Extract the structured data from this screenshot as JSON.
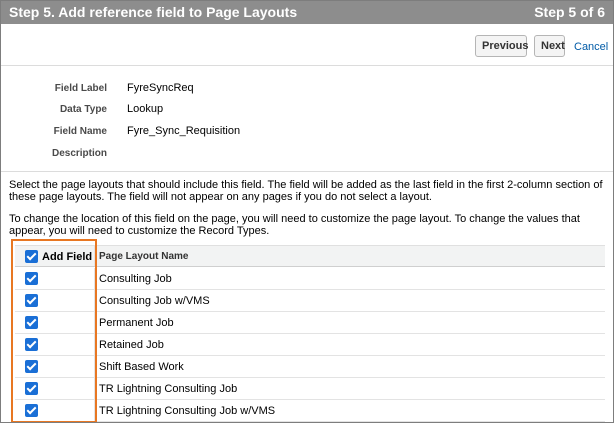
{
  "header": {
    "title": "Step 5. Add reference field to Page Layouts",
    "step": "Step 5 of 6"
  },
  "buttons": {
    "previous": "Previous",
    "next": "Next",
    "cancel": "Cancel"
  },
  "fields": [
    {
      "label": "Field Label",
      "value": "FyreSyncReq"
    },
    {
      "label": "Data Type",
      "value": "Lookup"
    },
    {
      "label": "Field Name",
      "value": "Fyre_Sync_Requisition"
    },
    {
      "label": "Description",
      "value": ""
    }
  ],
  "instructions": {
    "line1": "Select the page layouts that should include this field. The field will be added as the last field in the first 2-column section of these page layouts. The field will not appear on any pages if you do not select a layout.",
    "line2": "To change the location of this field on the page, you will need to customize the page layout. To change the values that appear, you will need to customize the Record Types."
  },
  "table": {
    "columns": {
      "add_field": "Add Field",
      "layout_name": "Page Layout Name"
    },
    "header_checked": true,
    "rows": [
      {
        "name": "Consulting Job",
        "checked": true
      },
      {
        "name": "Consulting Job w/VMS",
        "checked": true
      },
      {
        "name": "Permanent Job",
        "checked": true
      },
      {
        "name": "Retained Job",
        "checked": true
      },
      {
        "name": "Shift Based Work",
        "checked": true
      },
      {
        "name": "TR Lightning Consulting Job",
        "checked": true
      },
      {
        "name": "TR Lightning Consulting Job w/VMS",
        "checked": true
      }
    ]
  },
  "colors": {
    "header_bg": "#8d8d8d",
    "checkbox": "#1a6fd6",
    "highlight": "#e87722",
    "link": "#015ba7"
  }
}
